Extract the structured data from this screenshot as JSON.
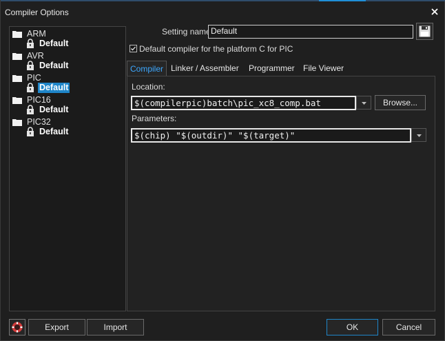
{
  "window": {
    "title": "Compiler Options"
  },
  "tree": {
    "groups": [
      {
        "label": "ARM",
        "child": "Default"
      },
      {
        "label": "AVR",
        "child": "Default"
      },
      {
        "label": "PIC",
        "child": "Default"
      },
      {
        "label": "PIC16",
        "child": "Default"
      },
      {
        "label": "PIC32",
        "child": "Default"
      }
    ],
    "selected_group": "PIC"
  },
  "setting": {
    "label": "Setting name:",
    "value": "Default"
  },
  "default_checkbox": {
    "label": "Default compiler for the platform C for PIC",
    "checked": true
  },
  "tabs": [
    {
      "label": "Compiler",
      "active": true
    },
    {
      "label": "Linker / Assembler",
      "active": false
    },
    {
      "label": "Programmer",
      "active": false
    },
    {
      "label": "File Viewer",
      "active": false
    }
  ],
  "compiler": {
    "location_label": "Location:",
    "location_value": "$(compilerpic)batch\\pic_xc8_comp.bat",
    "browse_label": "Browse...",
    "parameters_label": "Parameters:",
    "parameters_value": "$(chip) \"$(outdir)\" \"$(target)\""
  },
  "footer": {
    "export_label": "Export",
    "import_label": "Import",
    "ok_label": "OK",
    "cancel_label": "Cancel"
  },
  "icons": {
    "close": "close-icon",
    "folder": "folder-icon",
    "lock": "lock-icon",
    "save": "floppy-disk-icon",
    "help": "help-icon",
    "dropdown": "chevron-down-icon"
  },
  "colors": {
    "accent": "#1f86c9",
    "active_tab_text": "#3da8ff",
    "background": "#1f1f1f"
  }
}
